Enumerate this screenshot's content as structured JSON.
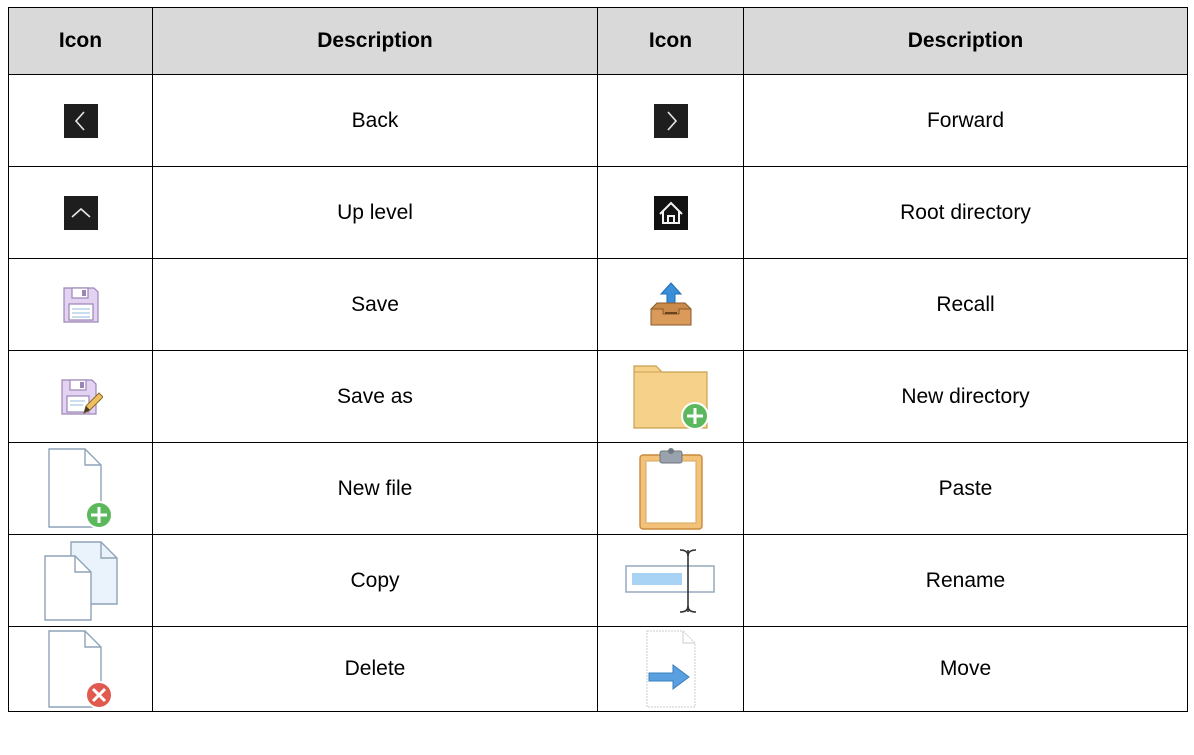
{
  "table": {
    "headers": [
      "Icon",
      "Description",
      "Icon",
      "Description"
    ],
    "rows": [
      [
        {
          "icon": "back-icon",
          "label": "Back"
        },
        {
          "icon": "forward-icon",
          "label": "Forward"
        }
      ],
      [
        {
          "icon": "up-level-icon",
          "label": "Up level"
        },
        {
          "icon": "home-icon",
          "label": "Root directory"
        }
      ],
      [
        {
          "icon": "save-icon",
          "label": "Save"
        },
        {
          "icon": "recall-icon",
          "label": "Recall"
        }
      ],
      [
        {
          "icon": "save-as-icon",
          "label": "Save as"
        },
        {
          "icon": "new-directory-icon",
          "label": "New directory"
        }
      ],
      [
        {
          "icon": "new-file-icon",
          "label": "New file"
        },
        {
          "icon": "paste-icon",
          "label": "Paste"
        }
      ],
      [
        {
          "icon": "copy-icon",
          "label": "Copy"
        },
        {
          "icon": "rename-icon",
          "label": "Rename"
        }
      ],
      [
        {
          "icon": "delete-icon",
          "label": "Delete"
        },
        {
          "icon": "move-icon",
          "label": "Move"
        }
      ]
    ]
  },
  "colors": {
    "header_bg": "#d9d9d9",
    "dark_icon_bg": "#1e1e1e",
    "folder": "#f6d18a",
    "green_badge": "#5cb85c",
    "red_badge": "#e05a4f",
    "blue_arrow": "#3a8fd8"
  }
}
